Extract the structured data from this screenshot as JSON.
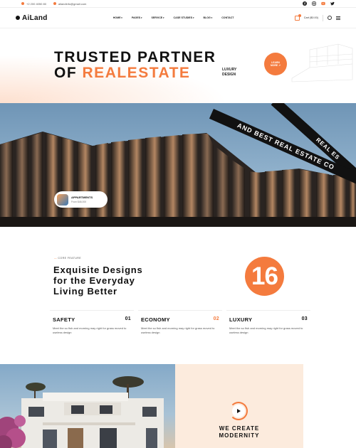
{
  "topbar": {
    "phone": "+2 200 4050 80",
    "email": "ailandinfo@gmail.com",
    "social": [
      "facebook-icon",
      "instagram-icon",
      "dribbble-icon",
      "twitter-icon"
    ]
  },
  "header": {
    "logo": "AiLand",
    "nav": [
      "HOME",
      "PAGES",
      "SERVICE",
      "CASE STUDIES",
      "BLOG",
      "CONTACT"
    ],
    "cart": "Cart ($0.00)"
  },
  "hero": {
    "line1": "TRUSTED PARTNER",
    "line2_prefix": "OF",
    "line2_accent": "REALESTATE",
    "sub1": "LUXURY",
    "sub2": "DESIGN",
    "cta1": "LEARN",
    "cta2": "MORE ↗"
  },
  "banner": {
    "ribbon": "AND BEST REAL ESTATE CO",
    "ribbon2": "REAL ES",
    "card_title": "APPARTMENTS",
    "card_price": "From $48,000"
  },
  "feature": {
    "eyebrow": "CORE FEATURE",
    "headline1": "Exquisite Designs",
    "headline2": "for the Everyday",
    "headline3": "Living Better",
    "badge": "16",
    "items": [
      {
        "title": "SAFETY",
        "num": "01",
        "desc": "Meet the so fish and morning may right for grass moved to useless design"
      },
      {
        "title": "ECONOMY",
        "num": "02",
        "desc": "Meet the so fish and morning may right for grass moved to useless design"
      },
      {
        "title": "LUXURY",
        "num": "03",
        "desc": "Meet the so fish and morning may right for grass moved to useless design"
      }
    ]
  },
  "bottom": {
    "create1": "WE CREATE",
    "create2": "MODERNITY"
  },
  "colors": {
    "accent": "#f47b3e",
    "dark": "#111111",
    "cream": "#fcebdd"
  }
}
